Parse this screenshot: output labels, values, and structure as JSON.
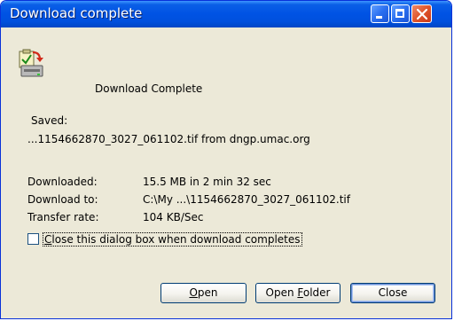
{
  "window": {
    "title": "Download complete",
    "controls": [
      "minimize-icon",
      "maximize-icon",
      "close-icon"
    ]
  },
  "header": {
    "icon": "download-complete-icon",
    "message": "Download Complete"
  },
  "saved": {
    "label": "Saved:",
    "value": "...1154662870_3027_061102.tif from dngp.umac.org"
  },
  "details": {
    "downloaded_label": "Downloaded:",
    "downloaded_value": "15.5 MB in 2 min 32 sec",
    "download_to_label": "Download to:",
    "download_to_value": "C:\\My ...\\1154662870_3027_061102.tif",
    "transfer_rate_label": "Transfer rate:",
    "transfer_rate_value": "104 KB/Sec"
  },
  "option": {
    "close_when_done_label_accel": "C",
    "close_when_done_label_rest": "lose this dialog box when download completes",
    "checked": false
  },
  "buttons": {
    "open_accel": "O",
    "open_rest": "pen",
    "open_folder_pre": "Open ",
    "open_folder_accel": "F",
    "open_folder_rest": "older",
    "close": "Close"
  },
  "colors": {
    "titlebar": "#0053e4",
    "dialog_background": "#ece9d8",
    "close_button": "#e0552b"
  }
}
